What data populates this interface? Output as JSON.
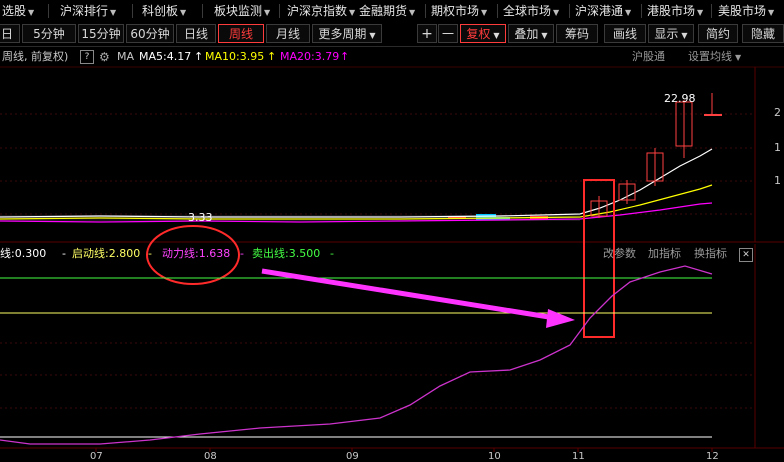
{
  "menubar": {
    "items": [
      {
        "label": "选股",
        "arrow": "▼"
      },
      {
        "label": "沪深排行",
        "arrow": "▼"
      },
      {
        "label": "科创板",
        "arrow": "▼"
      },
      {
        "label": "板块监测",
        "arrow": "▼"
      },
      {
        "label": "沪深京指数",
        "arrow": "▼"
      },
      {
        "label": "金融期货",
        "arrow": "▼"
      },
      {
        "label": "期权市场",
        "arrow": "▼"
      },
      {
        "label": "全球市场",
        "arrow": "▼"
      },
      {
        "label": "沪深港通",
        "arrow": "▼"
      },
      {
        "label": "港股市场",
        "arrow": "▼"
      },
      {
        "label": "美股市场",
        "arrow": "▼"
      }
    ]
  },
  "toolbar": {
    "periods": [
      "日",
      "5分钟",
      "15分钟",
      "60分钟",
      "日线",
      "周线",
      "月线",
      "更多周期"
    ],
    "more_arrow": "▼",
    "active_period": "周线",
    "plus": "+",
    "minus": "一",
    "fq_label": "复权",
    "fq_arrow": "▼",
    "overlay_label": "叠加",
    "overlay_arrow": "▼",
    "chips_label": "筹码",
    "draw_label": "画线",
    "display_label": "显示",
    "display_arrow": "▼",
    "simple_label": "简约",
    "hide_label": "隐藏"
  },
  "infobar": {
    "period_text": "周线, 前复权)",
    "help_icon": "?",
    "gear_icon": "⚙",
    "ma_label": "MA",
    "ma5": "MA5:4.17",
    "ma10": "MA10:3.95",
    "ma20": "MA20:3.79",
    "up_arrow": "↑",
    "hgt_label": "沪股通",
    "set_ma_label": "设置均线",
    "set_ma_arrow": "▼",
    "colors": {
      "ma5": "#ffffff",
      "ma10": "#ffff00",
      "ma20": "#ff00ff"
    }
  },
  "price_panel": {
    "high_label": "22.98",
    "low_label": "3.33",
    "axis_labels": [
      "2",
      "1",
      "1"
    ]
  },
  "indicator": {
    "buy_line": "线:0.300",
    "start_line": "启动线:2.800",
    "power_line": "动力线:1.638",
    "sell_line": "卖出线:3.500",
    "dash": "-",
    "change_param": "改参数",
    "add_indicator": "加指标",
    "switch_indicator": "换指标",
    "close_icon": "✕",
    "colors": {
      "buy": "#ffffff",
      "start": "#ffff66",
      "power": "#ff44ff",
      "sell": "#44ff44"
    }
  },
  "xaxis": {
    "labels": [
      "07",
      "08",
      "09",
      "10",
      "11",
      "12"
    ]
  }
}
